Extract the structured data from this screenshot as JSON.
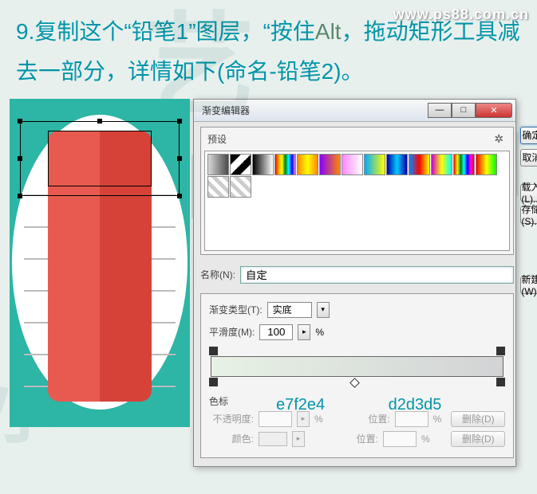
{
  "watermark": "www.ps88.com.cn",
  "instruction": {
    "step": "9.",
    "text1": "复制这个“铅笔1”图层，“按住",
    "alt": "Alt",
    "text2": "，拖动矩形工具减去一部分，详情如下(命名-铅笔2)。"
  },
  "dialog": {
    "title": "渐变编辑器",
    "buttons": {
      "ok": "确定",
      "cancel": "取消",
      "load": "载入(L)...",
      "save": "存储(S)...",
      "new": "新建(W)",
      "delete": "删除(D)"
    },
    "presets_label": "预设",
    "name_label": "名称(N):",
    "name_value": "自定",
    "gradtype_label": "渐变类型(T):",
    "gradtype_value": "实底",
    "smooth_label": "平滑度(M):",
    "smooth_value": "100",
    "percent": "%",
    "stops_label": "色标",
    "opacity_label": "不透明度:",
    "position_label": "位置:",
    "color_label": "颜色:",
    "hex1": "e7f2e4",
    "hex2": "d2d3d5"
  },
  "swatches": [
    "linear-gradient(to right,#d8d8d8,#4a4a4a)",
    "linear-gradient(to bottom right,#000 25%,#fff 25%,#fff 50%,#000 50%,#000 75%,#fff 75%)",
    "linear-gradient(to right,#000,#fff)",
    "linear-gradient(to right,red,orange,yellow,green,cyan,blue,violet)",
    "linear-gradient(to right,#f80,#ff0,#f80)",
    "linear-gradient(to right,#80f,#f80)",
    "linear-gradient(to right,#f8f,transparent)",
    "linear-gradient(to right,#0af,#ff0)",
    "linear-gradient(to right,#00a,#0cf,#00a)",
    "linear-gradient(to right,#08f,#f00,#ff0)",
    "linear-gradient(to right,#c0c,#ff0,#0ff)",
    "linear-gradient(to right,red,yellow,green,cyan,blue,magenta,red)",
    "linear-gradient(to right,#f00,#ff0,#0f0)",
    "repeating-linear-gradient(45deg,#ccc 0 5px,#fff 5px 10px)",
    "repeating-linear-gradient(45deg,#ccc 0 5px,#fff 5px 10px)"
  ]
}
